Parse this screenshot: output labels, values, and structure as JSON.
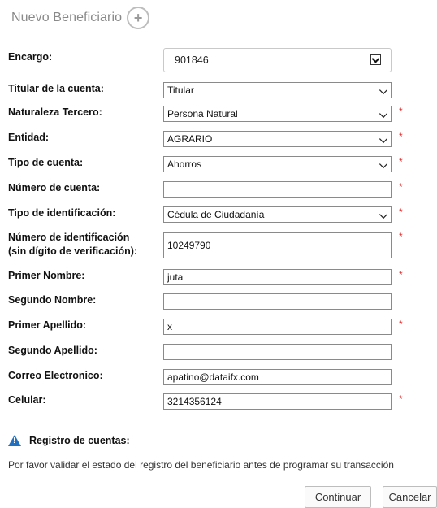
{
  "header": {
    "title": "Nuevo Beneficiario",
    "add_icon": "plus-circle-icon"
  },
  "form": {
    "encargo": {
      "label": "Encargo:",
      "value": "901846"
    },
    "titular": {
      "label": "Titular de la cuenta:",
      "value": "Titular"
    },
    "naturaleza": {
      "label": "Naturaleza Tercero:",
      "value": "Persona Natural",
      "required": "*"
    },
    "entidad": {
      "label": "Entidad:",
      "value": "AGRARIO",
      "required": "*"
    },
    "tipo_cuenta": {
      "label": "Tipo de cuenta:",
      "value": "Ahorros",
      "required": "*"
    },
    "numero_cuenta": {
      "label": "Número de cuenta:",
      "value": "",
      "required": "*"
    },
    "tipo_id": {
      "label": "Tipo de identificación:",
      "value": "Cédula de Ciudadanía",
      "required": "*"
    },
    "numero_id": {
      "label_line1": "Número de identificación",
      "label_line2": "(sin dígito de verificación):",
      "value": "10249790",
      "required": "*"
    },
    "primer_nombre": {
      "label": "Primer Nombre:",
      "value": "juta",
      "required": "*"
    },
    "segundo_nombre": {
      "label": "Segundo Nombre:",
      "value": ""
    },
    "primer_apellido": {
      "label": "Primer Apellido:",
      "value": "x",
      "required": "*"
    },
    "segundo_apellido": {
      "label": "Segundo Apellido:",
      "value": ""
    },
    "correo": {
      "label": "Correo Electronico:",
      "value": "apatino@dataifx.com"
    },
    "celular": {
      "label": "Celular:",
      "value": "3214356124",
      "required": "*"
    }
  },
  "notice": {
    "icon": "warning-icon",
    "title": "Registro de cuentas:",
    "message": "Por favor validar el estado del registro del beneficiario antes de programar su transacción"
  },
  "buttons": {
    "continue": "Continuar",
    "cancel": "Cancelar"
  },
  "colors": {
    "required": "#e03030",
    "warning_icon": "#1f6fc2"
  }
}
